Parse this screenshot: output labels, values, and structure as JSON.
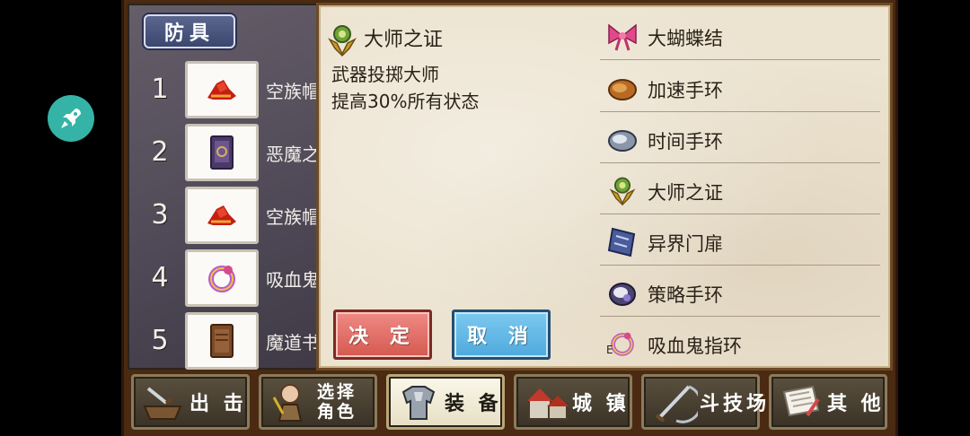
{
  "category_tab": "防具",
  "slots": [
    {
      "number": "1",
      "name": "空族帽",
      "icon": "red-hat-icon"
    },
    {
      "number": "2",
      "name": "恶魔之",
      "icon": "purple-book-icon"
    },
    {
      "number": "3",
      "name": "空族帽",
      "icon": "red-hat-icon"
    },
    {
      "number": "4",
      "name": "吸血鬼",
      "icon": "vampire-ring-icon"
    },
    {
      "number": "5",
      "name": "魔道书",
      "icon": "brown-book-icon"
    }
  ],
  "detail": {
    "title": "大师之证",
    "description": "武器投掷大师\n提高30%所有状态",
    "icon": "master-medal-icon"
  },
  "buttons": {
    "confirm": "决 定",
    "cancel": "取 消"
  },
  "items": [
    {
      "label": "大蝴蝶结",
      "icon": "bow-icon"
    },
    {
      "label": "加速手环",
      "icon": "speed-bracelet-icon"
    },
    {
      "label": "时间手环",
      "icon": "time-bracelet-icon"
    },
    {
      "label": "大师之证",
      "icon": "master-medal-icon"
    },
    {
      "label": "异界门扉",
      "icon": "portal-card-icon"
    },
    {
      "label": "策略手环",
      "icon": "strategy-bracelet-icon"
    },
    {
      "label": "吸血鬼指环",
      "icon": "vampire-ring-icon"
    }
  ],
  "list_marker": "E",
  "nav": [
    {
      "label": "出 击",
      "icon": "sortie-icon"
    },
    {
      "label": "选择\n角色",
      "icon": "character-icon"
    },
    {
      "label": "装 备",
      "icon": "armor-icon",
      "active": true
    },
    {
      "label": "城 镇",
      "icon": "town-icon"
    },
    {
      "label": "斗技场",
      "icon": "arena-icon"
    },
    {
      "label": "其 他",
      "icon": "scroll-icon"
    }
  ],
  "colors": {
    "confirm": "#d5584f",
    "cancel": "#4ea9dc",
    "frame": "#4a2a12",
    "parchment": "#ece3d0",
    "float_button": "#35b3a6"
  }
}
